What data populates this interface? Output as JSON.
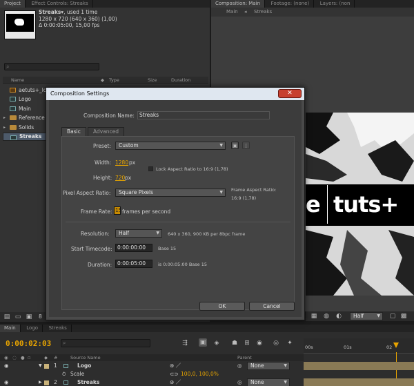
{
  "project_panel": {
    "tabs": [
      "Project",
      "Effect Controls: Streaks"
    ],
    "comp_name": "Streaks",
    "comp_used": ", used 1 time",
    "dimensions": "1280 x 720  (640 x 360) (1,00)",
    "duration_line": "Δ 0:00:05:00, 15,00 fps",
    "columns": [
      "Name",
      "Type",
      "Size",
      "Duration"
    ],
    "items": [
      {
        "label": "aetuts+_logo",
        "icon": "footage-icon"
      },
      {
        "label": "Logo",
        "icon": "composition-icon"
      },
      {
        "label": "Main",
        "icon": "composition-icon"
      },
      {
        "label": "Reference",
        "icon": "folder-icon"
      },
      {
        "label": "Solids",
        "icon": "folder-icon"
      },
      {
        "label": "Streaks",
        "icon": "composition-icon"
      }
    ],
    "bpc": "8"
  },
  "viewer": {
    "tabs": [
      "Composition: Main",
      "Footage: (none)",
      "Layers: (non"
    ],
    "breadcrumbs": [
      "Main",
      "Streaks"
    ],
    "footage_text_left": "e",
    "footage_text_right": "tuts+",
    "resolution": "Half"
  },
  "dialog": {
    "title": "Composition Settings",
    "close_label": "✕",
    "name_label": "Composition Name:",
    "name_value": "Streaks",
    "tabs": [
      "Basic",
      "Advanced"
    ],
    "preset_label": "Preset:",
    "preset_value": "Custom",
    "width_label": "Width:",
    "width_value": "1280",
    "width_unit": "px",
    "height_label": "Height:",
    "height_value": "720",
    "height_unit": "px",
    "lock_label": "Lock Aspect Ratio to 16:9 (1,78)",
    "par_label": "Pixel Aspect Ratio:",
    "par_value": "Square Pixels",
    "far_label": "Frame Aspect Ratio:",
    "far_value": "16:9 (1,78)",
    "fr_label": "Frame Rate:",
    "fr_value": "15",
    "fr_unit": "frames per second",
    "res_label": "Resolution:",
    "res_value": "Half",
    "res_info": "640 x 360, 900 KB per 8bpc frame",
    "start_label": "Start Timecode:",
    "start_value": "0:00:00:00",
    "start_base": "Base 15",
    "dur_label": "Duration:",
    "dur_value": "0:00:05:00",
    "dur_info": "is 0:00:05:00  Base 15",
    "ok_label": "OK",
    "cancel_label": "Cancel"
  },
  "timeline": {
    "tabs": [
      "Main",
      "Logo",
      "Streaks"
    ],
    "timecode": "0:00:02:03",
    "columns": {
      "source": "Source Name",
      "parent": "Parent"
    },
    "rows": [
      {
        "num": "1",
        "name": "Logo",
        "parent": "None"
      },
      {
        "num": "",
        "name": "Scale",
        "value": "100,0, 100,0%"
      },
      {
        "num": "2",
        "name": "Streaks",
        "parent": "None"
      }
    ],
    "ruler": [
      "00s",
      "01s",
      "02"
    ]
  }
}
